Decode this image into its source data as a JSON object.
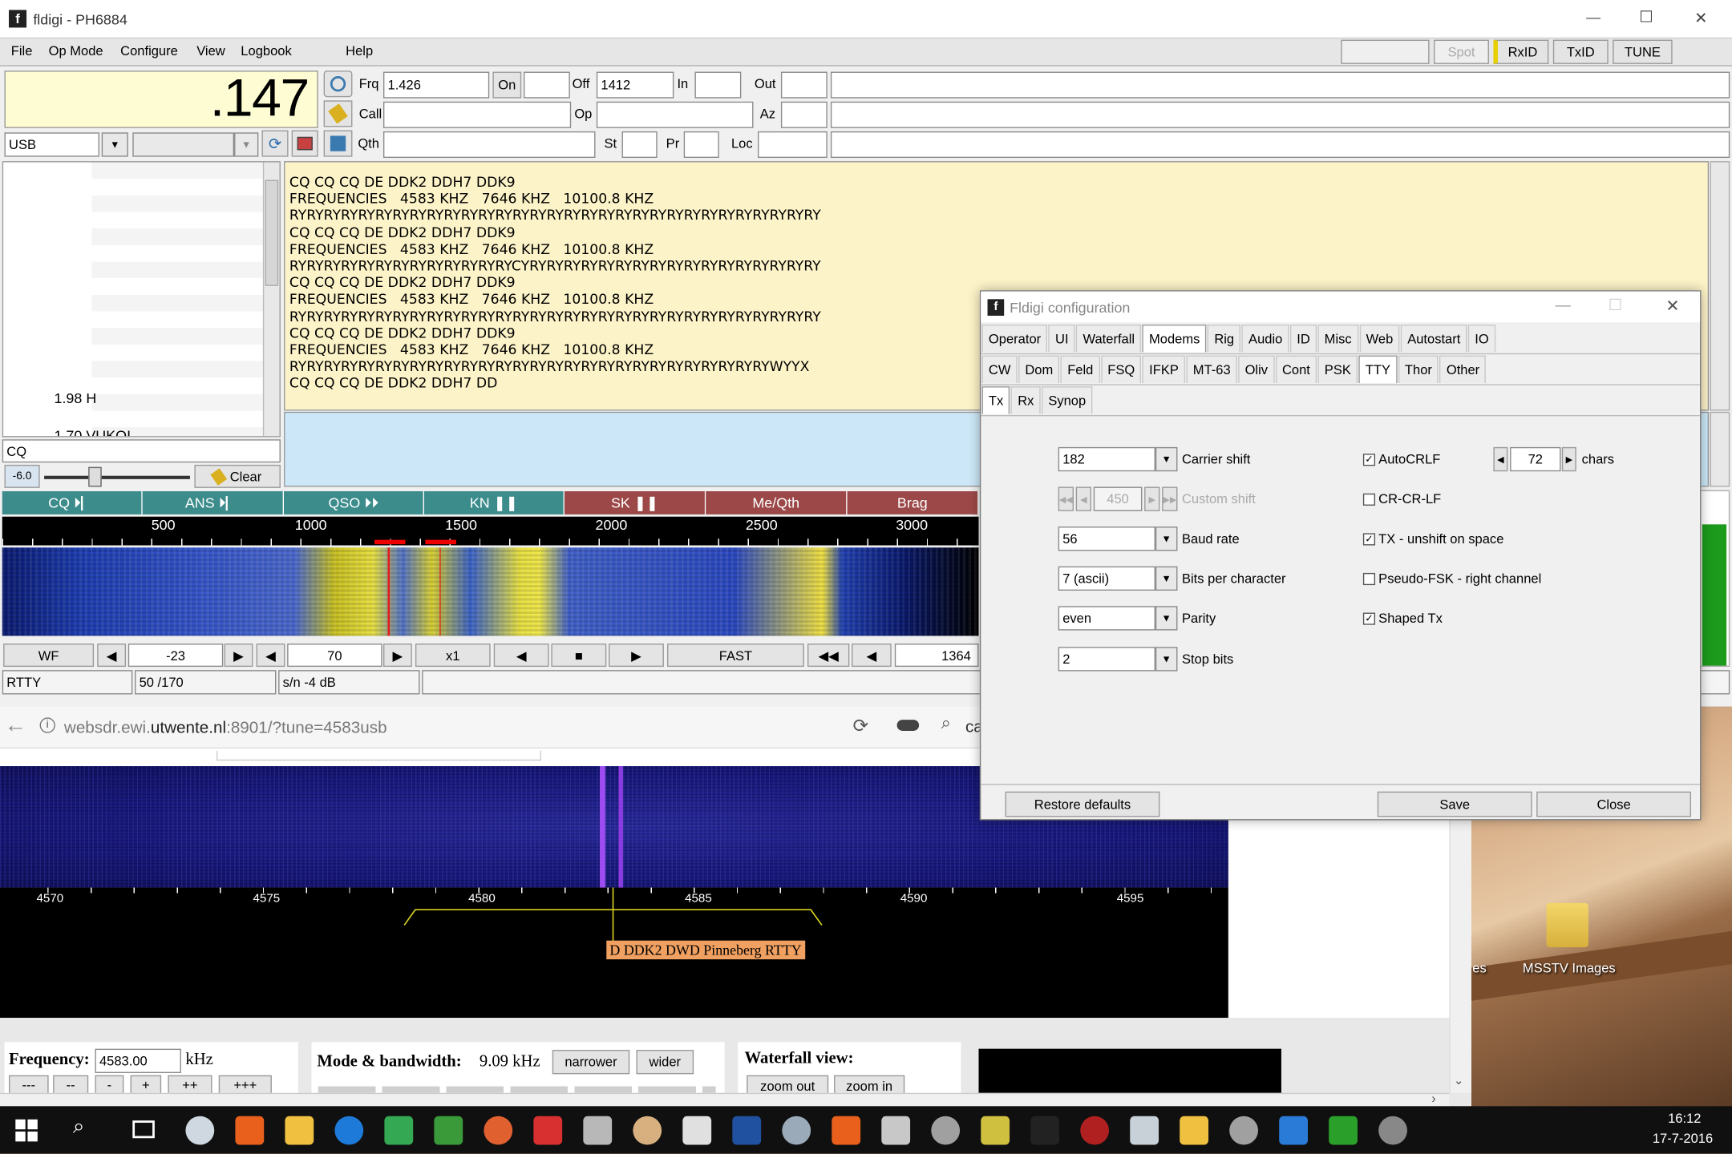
{
  "window": {
    "title": "fldigi - PH6884",
    "minimize": "—",
    "maximize": "☐",
    "close": "✕"
  },
  "menu": {
    "items": [
      "File",
      "Op Mode",
      "Configure",
      "View",
      "Logbook",
      "Help"
    ],
    "spot": "Spot",
    "rxid": "RxID",
    "txid": "TxID",
    "tune": "TUNE"
  },
  "freq_display": ".147",
  "mode_select": "USB",
  "log": {
    "frq_label": "Frq",
    "frq": "1.426",
    "on_label": "On",
    "off_label": "Off",
    "off": "1412",
    "in_label": "In",
    "out_label": "Out",
    "call_label": "Call",
    "op_label": "Op",
    "az_label": "Az",
    "qth_label": "Qth",
    "st_label": "St",
    "pr_label": "Pr",
    "loc_label": "Loc"
  },
  "browser_panel": {
    "value1": "1.98  H",
    "value2": "1.70  VUKOI"
  },
  "rx_text": [
    "CQ CQ CQ DE DDK2 DDH7 DDK9",
    "FREQUENCIES   4583 KHZ   7646 KHZ   10100.8 KHZ",
    "RYRYRYRYRYRYRYRYRYRYRYRYRYRYRYRYRYRYRYRYRYRYRYRYRYRYRYRYRYRYRY",
    "CQ CQ CQ DE DDK2 DDH7 DDK9",
    "FREQUENCIES   4583 KHZ   7646 KHZ   10100.8 KHZ",
    "RYRYRYRYRYRYRYRYRYRYRYRYRYCYRYRYRYRYRYRYRYRYRYRYRYRYRYRYRYRYRY",
    "CQ CQ CQ DE DDK2 DDH7 DDK9",
    "FREQUENCIES   4583 KHZ   7646 KHZ   10100.8 KHZ",
    "RYRYRYRYRYRYRYRYRYRYRYRYRYRYRYRYRYRYRYRYRYRYRYRYRYRYRYRYRYRYRY",
    "CQ CQ CQ DE DDK2 DDH7 DDK9",
    "FREQUENCIES   4583 KHZ   7646 KHZ   10100.8 KHZ",
    "RYRYRYRYRYRYRYRYRYRYRYRYRYRYRYRYRYRYRYRYRYRYRYRYRYRYRYRYWYYX",
    "CQ CQ CQ DE DDK2 DDH7 DD"
  ],
  "search_field": "CQ",
  "squelch_value": "-6.0",
  "clear_label": "Clear",
  "macros": [
    {
      "label": "CQ ⏵▏",
      "color": "#3c8c8c"
    },
    {
      "label": "ANS ⏵▏",
      "color": "#3c8c8c"
    },
    {
      "label": "QSO ⏵⏵",
      "color": "#3c8c8c"
    },
    {
      "label": "KN ❚❚",
      "color": "#3c8c8c"
    },
    {
      "label": "SK ❚❚",
      "color": "#9c4848"
    },
    {
      "label": "Me/Qth",
      "color": "#9c4848"
    },
    {
      "label": "Brag",
      "color": "#9c4848"
    }
  ],
  "scale_labels": [
    "500",
    "1000",
    "1500",
    "2000",
    "2500",
    "3000"
  ],
  "wf_controls": {
    "wf": "WF",
    "level": "-23",
    "range": "70",
    "zoom": "x1",
    "speed": "FAST",
    "freq": "1364"
  },
  "status": {
    "mode": "RTTY",
    "baud": "50 /170",
    "sn": "s/n -4  dB"
  },
  "browser": {
    "url_grey": "websdr.ewi.",
    "url_host": "utwente.nl",
    "url_rest": ":8901/?tune=4583usb",
    "search_text": "ca"
  },
  "sdr": {
    "ticks": [
      "4570",
      "4575",
      "4580",
      "4585",
      "4590",
      "4595"
    ],
    "label": "D DDK2 DWD Pinneberg RTTY",
    "freq_label": "Frequency:",
    "freq_value": "4583.00",
    "khz": "kHz",
    "step_buttons": [
      "---",
      "--",
      "-",
      "+",
      "++",
      "+++"
    ],
    "mode_label": "Mode & bandwidth:",
    "bandwidth": "9.09 kHz",
    "narrower": "narrower",
    "wider": "wider",
    "wf_label": "Waterfall view:",
    "zoom_out": "zoom out",
    "zoom_in": "zoom in"
  },
  "config": {
    "title": "Fldigi configuration",
    "tabs1": [
      "Operator",
      "UI",
      "Waterfall",
      "Modems",
      "Rig",
      "Audio",
      "ID",
      "Misc",
      "Web",
      "Autostart",
      "IO"
    ],
    "tabs1_active": "Modems",
    "tabs2": [
      "CW",
      "Dom",
      "Feld",
      "FSQ",
      "IFKP",
      "MT-63",
      "Oliv",
      "Cont",
      "PSK",
      "TTY",
      "Thor",
      "Other"
    ],
    "tabs2_active": "TTY",
    "tabs3": [
      "Tx",
      "Rx",
      "Synop"
    ],
    "tabs3_active": "Tx",
    "carrier_shift": "182",
    "carrier_shift_label": "Carrier shift",
    "custom_shift": "450",
    "custom_shift_label": "Custom shift",
    "baud_rate": "56",
    "baud_rate_label": "Baud rate",
    "bits": "7 (ascii)",
    "bits_label": "Bits per character",
    "parity": "even",
    "parity_label": "Parity",
    "stop_bits": "2",
    "stop_bits_label": "Stop bits",
    "autocrlf_label": "AutoCRLF",
    "autocrlf": true,
    "chars_value": "72",
    "chars_label": "chars",
    "crcrlf_label": "CR-CR-LF",
    "crcrlf": false,
    "tx_unshift_label": "TX - unshift on space",
    "tx_unshift": true,
    "pseudo_fsk_label": "Pseudo-FSK - right channel",
    "pseudo_fsk": false,
    "shaped_tx_label": "Shaped Tx",
    "shaped_tx": true,
    "restore_defaults": "Restore defaults",
    "save": "Save",
    "close": "Close"
  },
  "desktop": {
    "icon_label": "MSSTV Images",
    "partial": "es"
  },
  "taskbar": {
    "time": "16:12",
    "date": "17-7-2016"
  },
  "colors": {
    "rx_bg": "#fdf3c8",
    "tx_bg": "#cce8f8",
    "freq_bg": "#fefcd2",
    "accent": "#0078d7"
  }
}
